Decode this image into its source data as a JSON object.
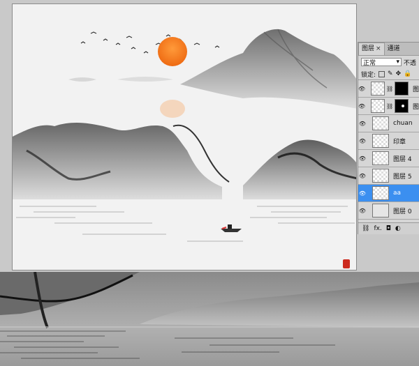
{
  "panel": {
    "tabs": [
      {
        "label": "图层",
        "active": true,
        "close_icon": "×"
      },
      {
        "label": "通道",
        "active": false
      }
    ],
    "blend_mode": "正常",
    "opacity_label": "不透",
    "lock_label": "锁定:",
    "layers": [
      {
        "name": "图",
        "type": "masked",
        "mask": "black",
        "visible": true
      },
      {
        "name": "图",
        "type": "masked",
        "mask": "dot",
        "visible": true
      },
      {
        "name": "chuan",
        "type": "normal",
        "visible": true
      },
      {
        "name": "印章",
        "type": "normal",
        "visible": true
      },
      {
        "name": "图层 4",
        "type": "normal",
        "visible": true
      },
      {
        "name": "图层 5",
        "type": "normal",
        "visible": true
      },
      {
        "name": "aa",
        "type": "normal",
        "visible": true,
        "selected": true
      },
      {
        "name": "图层 0",
        "type": "plain",
        "visible": true
      }
    ],
    "footer_icons": [
      "link-icon",
      "fx-icon",
      "mask-icon",
      "adjustment-icon"
    ],
    "fx_label": "fx."
  },
  "colors": {
    "sun": "#f07a1a",
    "selected_layer": "#3b8ff0",
    "seal": "#cc2a1e"
  }
}
